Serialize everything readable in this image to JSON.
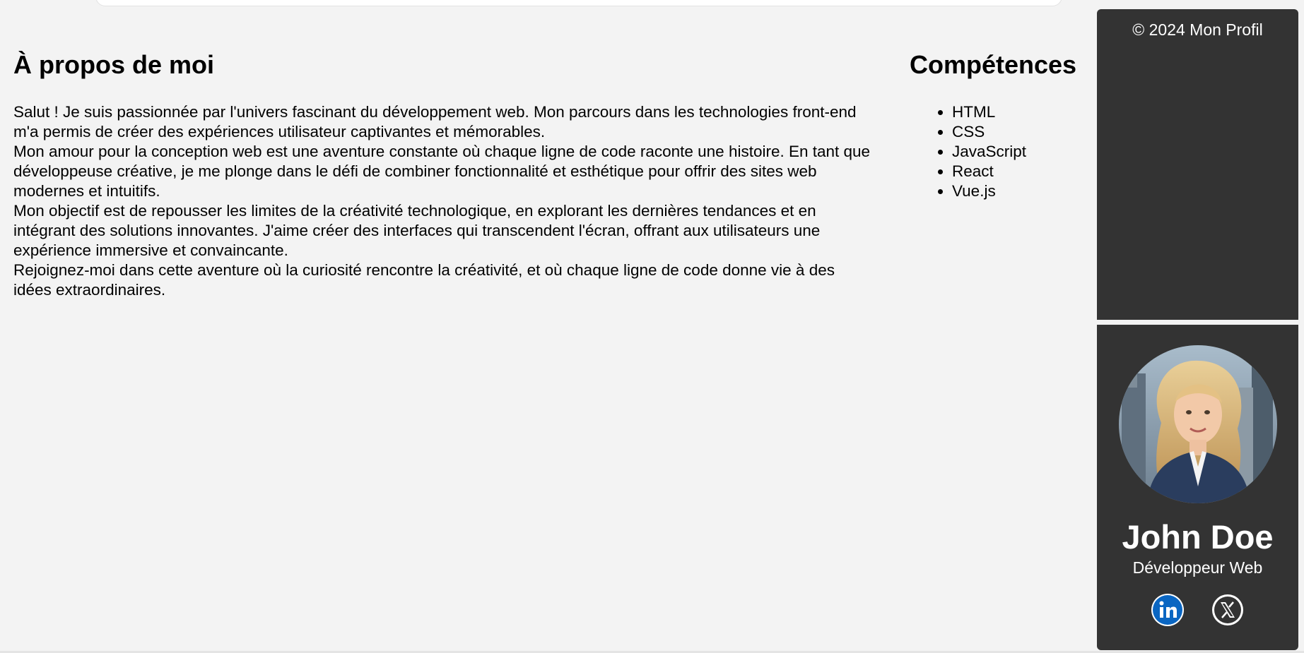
{
  "about": {
    "title": "À propos de moi",
    "paragraphs": [
      "Salut ! Je suis passionnée par l'univers fascinant du développement web. Mon parcours dans les technologies front-end m'a permis de créer des expériences utilisateur captivantes et mémorables.",
      "Mon amour pour la conception web est une aventure constante où chaque ligne de code raconte une histoire. En tant que développeuse créative, je me plonge dans le défi de combiner fonctionnalité et esthétique pour offrir des sites web modernes et intuitifs.",
      "Mon objectif est de repousser les limites de la créativité technologique, en explorant les dernières tendances et en intégrant des solutions innovantes. J'aime créer des interfaces qui transcendent l'écran, offrant aux utilisateurs une expérience immersive et convaincante.",
      "Rejoignez-moi dans cette aventure où la curiosité rencontre la créativité, et où chaque ligne de code donne vie à des idées extraordinaires."
    ]
  },
  "skills": {
    "title": "Compétences",
    "items": [
      "HTML",
      "CSS",
      "JavaScript",
      "React",
      "Vue.js"
    ]
  },
  "footer": {
    "copyright": "© 2024 Mon Profil"
  },
  "profile": {
    "name": "John Doe",
    "role": "Développeur Web",
    "avatar_icon": "portrait-photo",
    "socials": [
      {
        "icon": "linkedin-icon",
        "color": "#0a66c2"
      },
      {
        "icon": "x-twitter-icon",
        "color": "#ffffff"
      }
    ]
  },
  "colors": {
    "page_background": "#f3f3f3",
    "panel_background": "#333333",
    "panel_text": "#ffffff",
    "linkedin_blue": "#0a66c2"
  }
}
